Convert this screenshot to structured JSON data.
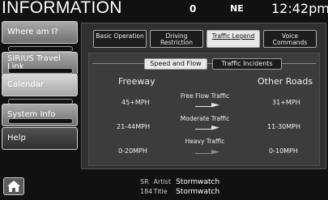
{
  "header": {
    "title": "INFORMATION",
    "status_number": "0",
    "compass": "NE",
    "clock": "12:42pm"
  },
  "sidebar": {
    "items": [
      {
        "label": "Where am I?"
      },
      {
        "label": "SIRIUS Travel Link"
      },
      {
        "label": "Calendar"
      },
      {
        "label": "System Info"
      },
      {
        "label": "Help"
      }
    ]
  },
  "tabs": [
    {
      "label": "Basic Operation",
      "active": false
    },
    {
      "label": "Driving Restriction",
      "active": false
    },
    {
      "label": "Traffic Legend",
      "active": true
    },
    {
      "label": "Voice Commands",
      "active": false
    }
  ],
  "subtabs": [
    {
      "label": "Speed and Flow",
      "active": true
    },
    {
      "label": "Traffic Incidents",
      "active": false
    }
  ],
  "legend": {
    "freeway_header": "Freeway",
    "other_header": "Other Roads",
    "rows": [
      {
        "freeway": "45+MPH",
        "label": "Free Flow Traffic",
        "other": "31+MPH",
        "arrow_color": "#e8e8e8"
      },
      {
        "freeway": "21-44MPH",
        "label": "Moderate Traffic",
        "other": "11-30MPH",
        "arrow_color": "#e8e8e8"
      },
      {
        "freeway": "0-20MPH",
        "label": "Heavy Traffic",
        "other": "0-10MPH",
        "arrow_color": "#8a8a8a"
      }
    ]
  },
  "now_playing": {
    "line1_label": "SR",
    "line1_key": "Artist",
    "line1_value": "Stormwatch",
    "line2_label": "184",
    "line2_key": "Title",
    "line2_value": "Stormwatch"
  },
  "home_icon": "house-icon"
}
